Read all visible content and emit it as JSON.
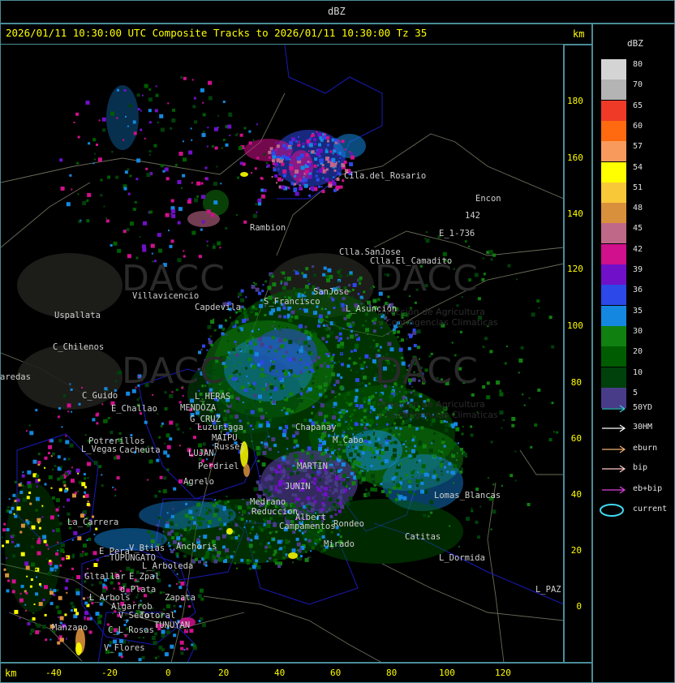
{
  "header": {
    "top_label": "dBZ",
    "title": "2026/01/11 10:30:00 UTC Composite Tracks to 2026/01/11 10:30:00 Tz 35",
    "km_top": "km",
    "km_bottom": "km"
  },
  "axes": {
    "y_ticks": [
      "180",
      "160",
      "140",
      "120",
      "100",
      "80",
      "60",
      "40",
      "20",
      "0"
    ],
    "x_ticks": [
      "-40",
      "-20",
      "0",
      "20",
      "40",
      "60",
      "80",
      "100",
      "120"
    ]
  },
  "legend": {
    "title": "dBZ",
    "levels": [
      {
        "label": "80",
        "color": "#d4d4d4"
      },
      {
        "label": "70",
        "color": "#b4b4b4"
      },
      {
        "label": "65",
        "color": "#f03a28"
      },
      {
        "label": "60",
        "color": "#ff6a10"
      },
      {
        "label": "57",
        "color": "#f89a5c"
      },
      {
        "label": "54",
        "color": "#ffff00"
      },
      {
        "label": "51",
        "color": "#f8c838"
      },
      {
        "label": "48",
        "color": "#d8903c"
      },
      {
        "label": "45",
        "color": "#c06888"
      },
      {
        "label": "42",
        "color": "#d0108c"
      },
      {
        "label": "39",
        "color": "#7010c8"
      },
      {
        "label": "36",
        "color": "#2c48e8"
      },
      {
        "label": "35",
        "color": "#1488e0"
      },
      {
        "label": "30",
        "color": "#108010"
      },
      {
        "label": "20",
        "color": "#005c00"
      },
      {
        "label": "10",
        "color": "#00400a"
      },
      {
        "label": "5",
        "color": "#483c88"
      }
    ],
    "tracks": [
      {
        "label": "50YD",
        "color": "#40c8d8"
      },
      {
        "label": "30HM",
        "color": "#ffffff"
      },
      {
        "label": "eburn",
        "color": "#f0b070"
      },
      {
        "label": "bip",
        "color": "#ffc8c8"
      },
      {
        "label": "eb+bip",
        "color": "#e040e0"
      },
      {
        "label": "current",
        "color": "#40d8f0"
      }
    ]
  },
  "places": [
    {
      "name": "Cila.del_Rosario"
    },
    {
      "name": "Encon"
    },
    {
      "name": "142"
    },
    {
      "name": "E_1-736"
    },
    {
      "name": "Rambion"
    },
    {
      "name": "Clla.SanJose"
    },
    {
      "name": "Clla.El_Camadito"
    },
    {
      "name": "Villavicencio"
    },
    {
      "name": "Capdevila"
    },
    {
      "name": "S_Francisco"
    },
    {
      "name": "SanJose"
    },
    {
      "name": "L_Asunción"
    },
    {
      "name": "Uspallata"
    },
    {
      "name": "C_Chilenos"
    },
    {
      "name": "aredas"
    },
    {
      "name": "C_Guido"
    },
    {
      "name": "E_Challao"
    },
    {
      "name": "L_HERAS"
    },
    {
      "name": "MENDOZA"
    },
    {
      "name": "G_CRUZ"
    },
    {
      "name": "Luzuriaga"
    },
    {
      "name": "Potrerillos"
    },
    {
      "name": "L_Vegas"
    },
    {
      "name": "Cacheuta"
    },
    {
      "name": "MAIPU"
    },
    {
      "name": "Russel"
    },
    {
      "name": "LUJAN"
    },
    {
      "name": "Perdriel"
    },
    {
      "name": "Agrelo"
    },
    {
      "name": "Chapanay"
    },
    {
      "name": "M_Cabo"
    },
    {
      "name": "MARTIN"
    },
    {
      "name": "JUNIN"
    },
    {
      "name": "Medrano"
    },
    {
      "name": "Reduccion"
    },
    {
      "name": "Campamentos"
    },
    {
      "name": "Mirado"
    },
    {
      "name": "Lomas_Blancas"
    },
    {
      "name": "Catitas"
    },
    {
      "name": "L_Dormida"
    },
    {
      "name": "L_PAZ"
    },
    {
      "name": "La_Carrera"
    },
    {
      "name": "E_Pera"
    },
    {
      "name": "V_Btias"
    },
    {
      "name": "TUPUNGATO"
    },
    {
      "name": "Anchoris"
    },
    {
      "name": "L_Arboleda"
    },
    {
      "name": "Gltallar"
    },
    {
      "name": "E_Zpal"
    },
    {
      "name": "d_Plata"
    },
    {
      "name": "L_Arbols"
    },
    {
      "name": "Zapata"
    },
    {
      "name": "Algarrob"
    },
    {
      "name": "V_Seco"
    },
    {
      "name": "Totoral"
    },
    {
      "name": "TUNUYAN"
    },
    {
      "name": "Manzano"
    },
    {
      "name": "C_L_Rosas"
    },
    {
      "name": "V_Flores"
    },
    {
      "name": "Rondeo"
    },
    {
      "name": "Albert"
    }
  ],
  "watermark": {
    "text": "DACC",
    "sub1": "Direccion de Agricultura",
    "sub2": "y Contingencias Climaticas"
  }
}
